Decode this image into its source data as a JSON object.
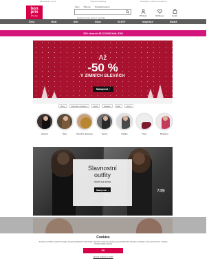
{
  "topbar": {
    "left": "Zákaznický servis",
    "middle": "Objednat katalog",
    "right": "Bezplatné vrácení a doprava"
  },
  "logo": {
    "line1": "bon",
    "line2": "prix",
    "line3": "it's me"
  },
  "search": {
    "tabs": [
      "Ženy",
      "Pánové",
      "Pozapřekvapení"
    ],
    "placeholder": "Hledaný výraz nebo č. výrobku"
  },
  "header_icons": [
    {
      "icon": "user-icon",
      "label": "Přihlásit"
    },
    {
      "icon": "heart-icon",
      "label": "Oblíbené"
    },
    {
      "icon": "bag-icon",
      "label": "Košík"
    }
  ],
  "nav": [
    "Ženy",
    "Muži",
    "Děti",
    "Obuv",
    "SLEVY",
    "Inspirace",
    "MAMA"
  ],
  "promo": "20% sleva do 26.12.2024! Kód: 3104",
  "hero": {
    "line1": "Až",
    "line2": "-50 %",
    "line3": "V ZIMNÍCH SLEVÁCH",
    "button": "Nakupovat"
  },
  "chips": [
    "Ženy",
    "Dámské oblečení",
    "Muži",
    "Dětské",
    "Děti",
    "Obuv"
  ],
  "categories": [
    {
      "label": "Večerní"
    },
    {
      "label": "Šaty"
    },
    {
      "label": "Vánoční dekorace"
    },
    {
      "label": "Svetry"
    },
    {
      "label": "Kabáty"
    },
    {
      "label": "Obuv"
    },
    {
      "label": "Bělostné"
    }
  ],
  "feature": {
    "title_line1": "Slavnostní",
    "title_line2": "outfity",
    "subtitle": "Ihned na doma",
    "button": "Nakupovat",
    "price": "749"
  },
  "cookie": {
    "title": "Cookies",
    "text": "Souhlas s použitím souborů cookies a jiných podobných technologií, aby Vám mohly být nabízeny personalizované obsahy a nabídky i mimo web bonprix. Souhlas můžete kdykoli odvolat.",
    "accept": "OK",
    "settings": "Upravit cookies a zavřít"
  },
  "colors": {
    "brand": "#d50047",
    "nav_bg": "#5d5d5d",
    "promo_bg": "#d4157b",
    "hero_bg": "#a8122e"
  }
}
